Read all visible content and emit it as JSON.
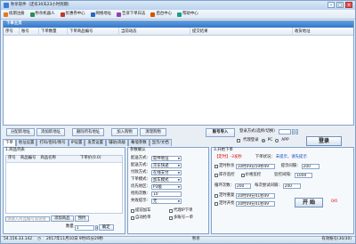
{
  "title": "秒杀软件（还有30天23小时到期）",
  "menu": [
    {
      "label": "续期注册",
      "color": "#e07a1e"
    },
    {
      "label": "秒杀机器人",
      "color": "#2e8b57"
    },
    {
      "label": "优惠券中心",
      "color": "#c0392b"
    },
    {
      "label": "网络地址",
      "color": "#2a66c2"
    },
    {
      "label": "告诉下单日志",
      "color": "#8e44ad"
    },
    {
      "label": "后台中心",
      "color": "#d35400"
    },
    {
      "label": "帮助中心",
      "color": "#16a085"
    }
  ],
  "grid": {
    "panel_title": "下单主页",
    "columns": [
      "序号",
      "账号",
      "下单数量",
      "下单商品编号",
      "当前动态",
      "提交结果",
      "收货地址"
    ]
  },
  "buttons": {
    "load_accounts": "分配新地址",
    "add_address": "添加新地址",
    "delete_address": "删除所有地址",
    "add_to_cart": "加入购物",
    "clear_cart": "清理购物",
    "account_import": "账号导入",
    "login": "登录",
    "login_mode_label": "登录方式(选择/切换）",
    "proxy_label": "代理登录",
    "pc_label": "PC",
    "app_label": "APP"
  },
  "tabs": [
    "下单",
    "地址设置",
    "打码/密码/限号",
    "IP设置",
    "发票设置",
    "辅助/高级",
    "幕墙参数",
    "显示/文档"
  ],
  "products": {
    "header": "1.商品列表",
    "cols": [
      "序号",
      "商品编号",
      "商品名称",
      "下单价(0.0)"
    ],
    "placeholder": "请输入商品编号或链接",
    "add_label": "添加商品",
    "preset_label": "预约",
    "qty_label": "数量",
    "qty_value": "1",
    "confirm_label": "确定"
  },
  "params": {
    "header": "参数确认",
    "rows": [
      {
        "label": "配送方式:",
        "value": "软件地址"
      },
      {
        "label": "配送方式:",
        "value": "京东快递"
      },
      {
        "label": "付款方式:",
        "value": "在线支付"
      },
      {
        "label": "下单模式:",
        "value": "加车模式"
      },
      {
        "label": "优先地区:",
        "value": "P3级"
      },
      {
        "label": "抢购次数:",
        "value": "10"
      },
      {
        "label": "失败提示:",
        "value": "无"
      }
    ],
    "opts": [
      {
        "label": "提前加车",
        "on": false
      },
      {
        "label": "自动抢单",
        "on": false
      },
      {
        "label": "代理IP下单",
        "on": false
      },
      {
        "label": "多账号一单",
        "on": false
      }
    ]
  },
  "start": {
    "header": "3.开始下单",
    "timer_label": "【定时】-3发秒",
    "order_mode_label": "下单状况：",
    "order_mode_value": "未提示，请先提示",
    "rows": [
      {
        "label": "定时秒杀",
        "value": "10时09分59秒49",
        "t2": "提示间隔：",
        "v2": "200"
      },
      {
        "label": "库存监控",
        "value": "价格监控",
        "t2": "监控间隔：",
        "v2": "1000"
      },
      {
        "label": "循环次数：",
        "value": "200",
        "t2": "每次尝试间隔：",
        "v2": "200"
      },
      {
        "label": "定时重复",
        "value": "10时09分41秒49",
        "t2": "",
        "v2": ""
      },
      {
        "label": "定时开抢",
        "value": "10时09分41秒49",
        "t2": "",
        "v2": ""
      }
    ],
    "start_label": "开 始",
    "count": "0/0"
  },
  "status": {
    "ip": "54.156.33.142",
    "time": "2017年11月10日 9时45分29秒",
    "mode": "秒杀",
    "accounts": "有效账号(30/30)"
  }
}
